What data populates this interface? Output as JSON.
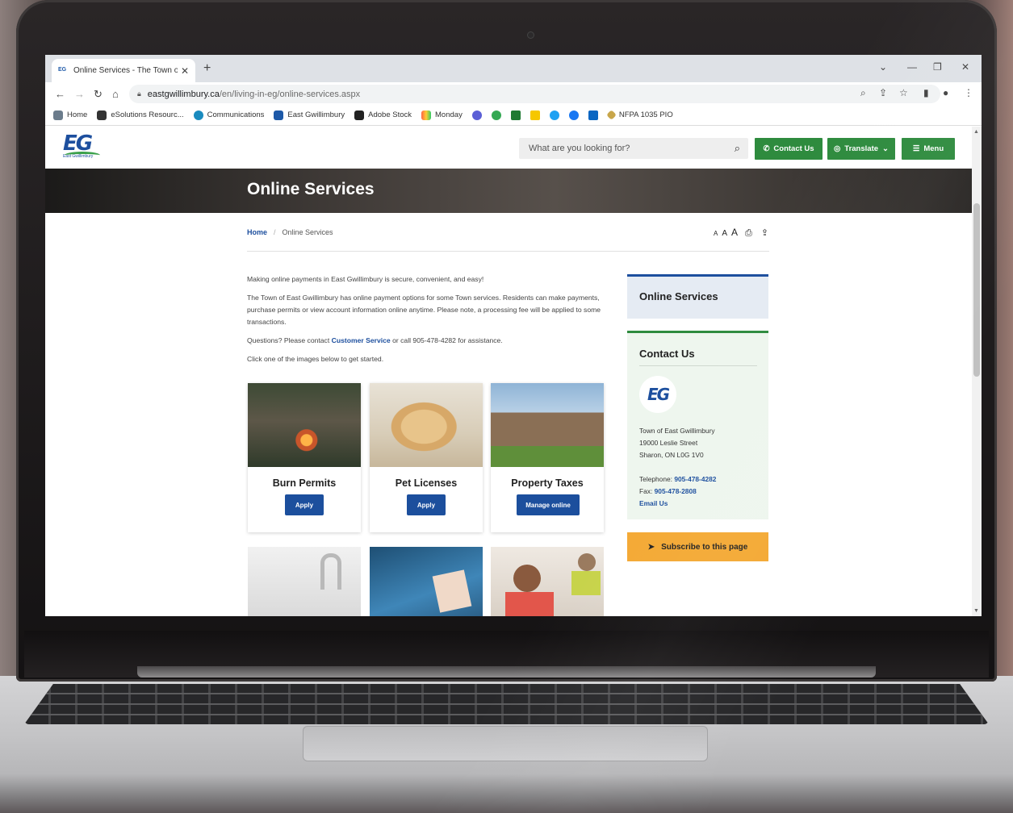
{
  "browser": {
    "tab_title": "Online Services - The Town of Ea",
    "tab_favicon": "EG",
    "new_tab": "+",
    "url_host": "eastgwillimbury.ca",
    "url_path": "/en/living-in-eg/online-services.aspx",
    "bookmarks": [
      "Home",
      "eSolutions Resourc...",
      "Communications",
      "East Gwillimbury",
      "Adobe Stock",
      "Monday",
      "NFPA 1035 PIO"
    ]
  },
  "site": {
    "logo_text": "EG",
    "logo_sub": "East Gwillimbury",
    "search_placeholder": "What are you looking for?",
    "contact_label": "Contact Us",
    "translate_label": "Translate",
    "menu_label": "Menu",
    "accent_green": "#2e8b3e",
    "accent_blue": "#1d4f9e",
    "accent_orange": "#f4a934"
  },
  "hero": {
    "title": "Online Services"
  },
  "breadcrumb": {
    "home": "Home",
    "sep": "/",
    "current": "Online Services"
  },
  "tools": {
    "small": "A",
    "medium": "A",
    "large": "A"
  },
  "intro": {
    "p1": "Making online payments in East Gwillimbury is secure, convenient, and easy!",
    "p2": "The Town of East Gwillimbury has online payment options for some Town services. Residents can make payments, purchase permits or view account information online anytime. Please note, a processing fee will be applied to some transactions.",
    "p3_before": "Questions? Please contact ",
    "p3_link": "Customer Service",
    "p3_after": " or call 905-478-4282 for assistance.",
    "p4": "Click one of the images below to get started."
  },
  "cards": [
    {
      "title": "Burn Permits",
      "button": "Apply"
    },
    {
      "title": "Pet Licenses",
      "button": "Apply"
    },
    {
      "title": "Property Taxes",
      "button": "Manage online"
    }
  ],
  "sidebar": {
    "online_services": "Online Services",
    "contact_heading": "Contact Us",
    "badge": "EG",
    "org": "Town of East Gwillimbury",
    "street": "19000 Leslie Street",
    "city": "Sharon, ON L0G 1V0",
    "tel_label": "Telephone: ",
    "tel": "905-478-4282",
    "fax_label": "Fax: ",
    "fax": "905-478-2808",
    "email": "Email Us",
    "subscribe": "Subscribe to this page"
  }
}
